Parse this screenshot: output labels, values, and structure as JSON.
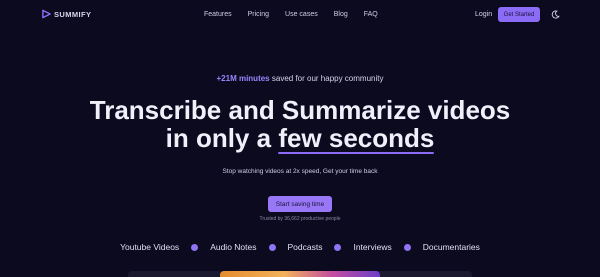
{
  "brand": {
    "name": "SUMMIFY",
    "logo_icon": "play-triangle-icon",
    "accent": "#8b6cf6"
  },
  "nav": {
    "links": [
      "Features",
      "Pricing",
      "Use cases",
      "Blog",
      "FAQ"
    ],
    "login_label": "Login",
    "cta_label": "Get Started",
    "theme_icon": "moon-icon"
  },
  "hero": {
    "tagline_highlight": "+21M minutes",
    "tagline_rest": "saved for our happy community",
    "headline_line1": "Transcribe and Summarize videos",
    "headline_line2_prefix": "in only a",
    "headline_line2_emphasis": "few seconds",
    "subtitle": "Stop watching videos at 2x speed, Get your time back",
    "cta_label": "Start saving time",
    "trusted_text": "Trusted by 36,662 productive people"
  },
  "features": [
    "Youtube Videos",
    "Audio Notes",
    "Podcasts",
    "Interviews",
    "Documentaries"
  ],
  "colors": {
    "background": "#0b0a1f",
    "accent": "#8b6cf6",
    "dot": "#8f74f3"
  }
}
